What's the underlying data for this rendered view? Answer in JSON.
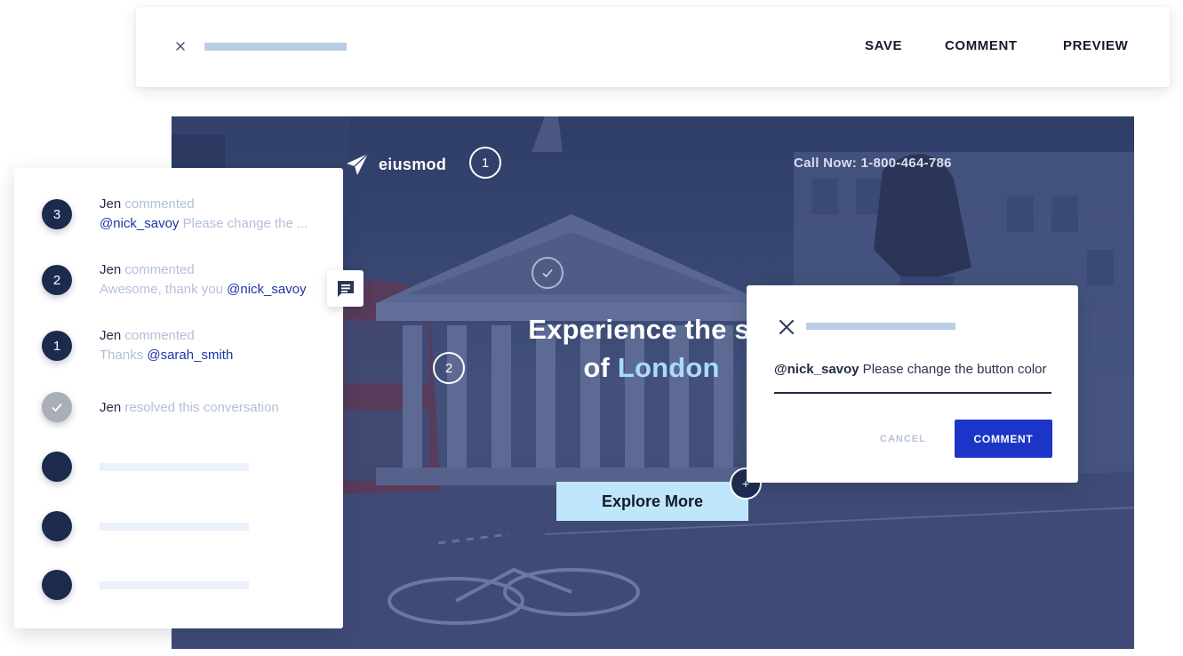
{
  "toolbar": {
    "save_label": "SAVE",
    "comment_label": "COMMENT",
    "preview_label": "PREVIEW"
  },
  "hero": {
    "brand_name": "eiusmod",
    "phone": "Call Now: 1-800-464-786",
    "headline_line1": "Experience the sig",
    "headline_line2_prefix": "of ",
    "headline_line2_accent": "London",
    "explore_label": "Explore More",
    "hotspots": {
      "one": "1",
      "two": "2",
      "plus": "+"
    },
    "colors": {
      "accent": "#a8dcf7",
      "button": "#bfe6fb"
    }
  },
  "dialog": {
    "mention": "@nick_savoy",
    "text": " Please change the button color",
    "cancel_label": "CANCEL",
    "comment_label": "COMMENT",
    "colors": {
      "primary": "#1c35c8"
    }
  },
  "sidebar": {
    "entries": [
      {
        "badge": "3",
        "user": "Jen",
        "action": " commented",
        "mention": "@nick_savoy",
        "text": " Please change the ..."
      },
      {
        "badge": "2",
        "user": "Jen",
        "action": " commented",
        "prefix": "Awesome, thank you ",
        "mention": "@nick_savoy"
      },
      {
        "badge": "1",
        "user": "Jen",
        "action": " commented",
        "prefix": "Thanks ",
        "mention": "@sarah_smith"
      },
      {
        "badge_icon": "check-icon",
        "user": "Jen",
        "action": " resolved this conversation"
      }
    ]
  }
}
